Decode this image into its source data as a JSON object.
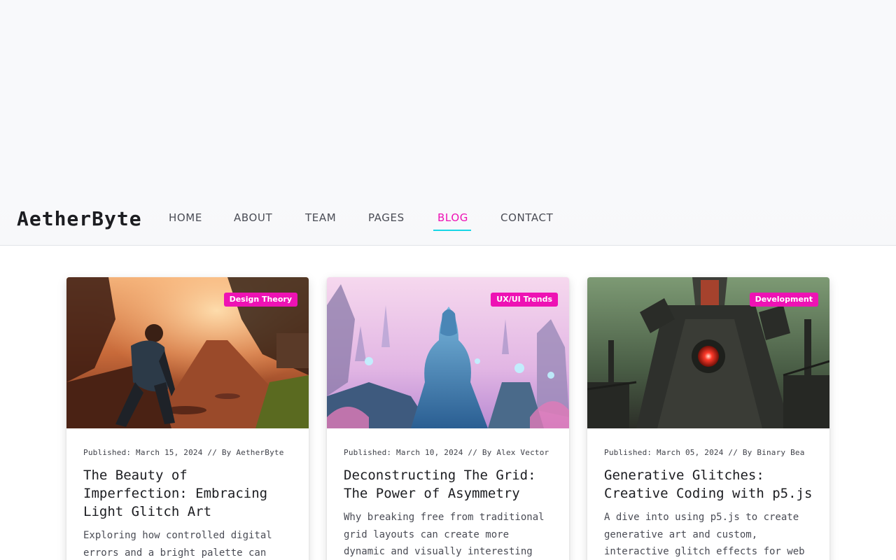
{
  "brand": {
    "name": "AetherByte"
  },
  "nav": {
    "items": [
      {
        "label": "HOME"
      },
      {
        "label": "ABOUT"
      },
      {
        "label": "TEAM"
      },
      {
        "label": "PAGES"
      },
      {
        "label": "BLOG"
      },
      {
        "label": "CONTACT"
      }
    ],
    "active": "BLOG"
  },
  "colors": {
    "accent": "#ee12b4",
    "underline": "#19d6e6",
    "text": "#1c1d21"
  },
  "posts": [
    {
      "tag": "Design Theory",
      "meta": "Published: March 15, 2024 // By AetherByte",
      "title": "The Beauty of Imperfection: Embracing Light Glitch Art",
      "excerpt": "Exploring how controlled digital errors and a bright palette can"
    },
    {
      "tag": "UX/UI Trends",
      "meta": "Published: March 10, 2024 // By Alex Vector",
      "title": "Deconstructing The Grid: The Power of Asymmetry",
      "excerpt": "Why breaking free from traditional grid layouts can create more dynamic and visually interesting"
    },
    {
      "tag": "Development",
      "meta": "Published: March 05, 2024 // By Binary Bea",
      "title": "Generative Glitches: Creative Coding with p5.js",
      "excerpt": "A dive into using p5.js to create generative art and custom, interactive glitch effects for web"
    }
  ]
}
